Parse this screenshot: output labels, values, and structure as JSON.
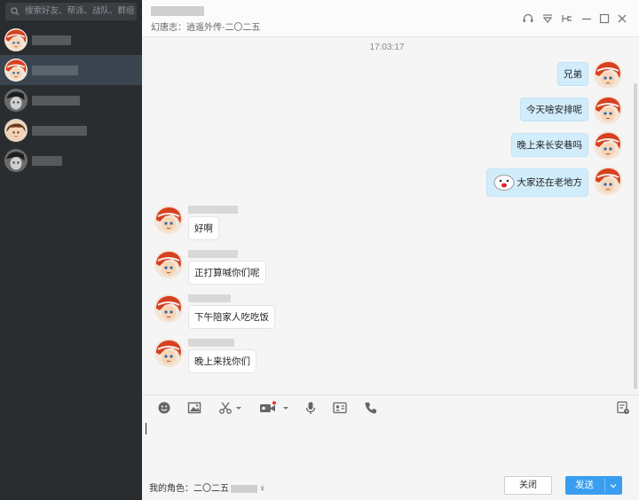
{
  "sidebar": {
    "search_placeholder": "搜索好友、帮派、战队、群组"
  },
  "header": {
    "subtitle": "幻唐志：逍遥外传-二〇二五"
  },
  "chat": {
    "timestamp": "17:03:17",
    "sent": [
      {
        "text": "兄弟"
      },
      {
        "text": "今天啥安排呢"
      },
      {
        "text": "晚上来长安巷吗"
      },
      {
        "text": "大家还在老地方"
      }
    ],
    "received": [
      {
        "text": "好啊"
      },
      {
        "text": "正打算喊你们呢"
      },
      {
        "text": "下午陪家人吃吃饭"
      },
      {
        "text": "晚上来找你们"
      }
    ]
  },
  "footer": {
    "role_prefix": "我的角色：",
    "role_name": "二〇二五",
    "gender_symbol": "♀",
    "close_label": "关闭",
    "send_label": "发送"
  },
  "colors": {
    "sidebar_bg": "#2a2d30",
    "sent_bubble": "#d1ecfb",
    "send_button": "#3a9ef0"
  }
}
